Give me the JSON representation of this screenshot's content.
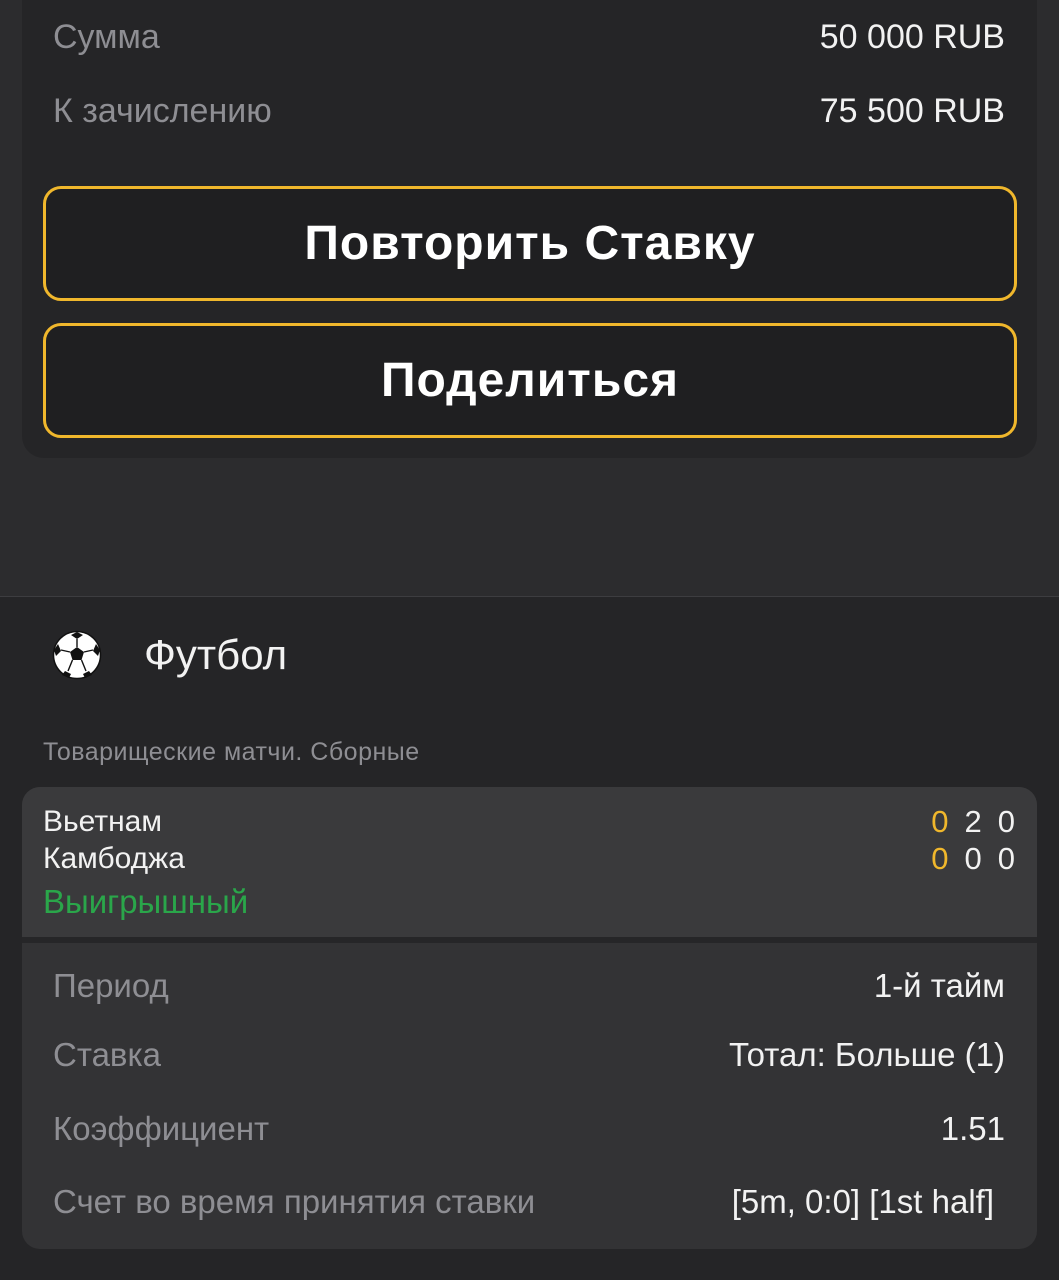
{
  "summary": {
    "sum_label": "Сумма",
    "sum_value": "50 000 RUB",
    "credit_label": "К зачислению",
    "credit_value": "75 500 RUB"
  },
  "actions": {
    "repeat_label": "Повторить Ставку",
    "share_label": "Поделиться"
  },
  "event": {
    "sport_icon": "soccer-ball-icon",
    "sport": "Футбол",
    "league": "Товарищеские матчи. Сборные",
    "team1": "Вьетнам",
    "team2": "Камбоджа",
    "score1": [
      "0",
      "2",
      "0"
    ],
    "score2": [
      "0",
      "0",
      "0"
    ],
    "status": "Выигрышный",
    "details": {
      "period_label": "Период",
      "period_value": "1-й тайм",
      "bet_label": "Ставка",
      "bet_value": "Тотал: Больше (1)",
      "coef_label": "Коэффициент",
      "coef_value": "1.51",
      "score_label": "Счет во время принятия ставки",
      "score_value": "[5m, 0:0] [1st half]"
    }
  },
  "colors": {
    "accent": "#f0b72c",
    "won": "#2aa64a",
    "background": "#2c2c2e",
    "card": "#252527"
  }
}
